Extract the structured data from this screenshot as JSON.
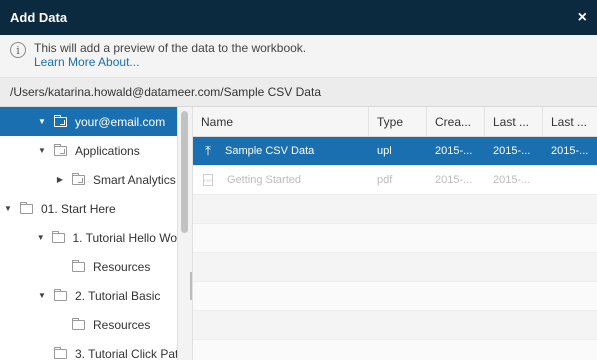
{
  "dialog": {
    "title": "Add Data",
    "close_glyph": "×"
  },
  "info": {
    "icon": "i",
    "message": "This will add a preview of the data to the workbook.",
    "link": "Learn More About..."
  },
  "path": "/Users/katarina.howald@datameer.com/Sample CSV Data",
  "tree": {
    "items": [
      {
        "label": "your@email.com",
        "caret": "▼",
        "icon": "shared-folder-icon"
      },
      {
        "label": "Applications",
        "caret": "▼",
        "icon": "shared-folder-icon"
      },
      {
        "label": "Smart Analytics",
        "caret": "▶",
        "icon": "shared-folder-icon"
      },
      {
        "label": "01. Start Here",
        "caret": "▼",
        "icon": "folder-icon"
      },
      {
        "label": "1. Tutorial Hello Wo",
        "caret": "▼",
        "icon": "folder-icon"
      },
      {
        "label": "Resources",
        "caret": "",
        "icon": "folder-icon"
      },
      {
        "label": "2. Tutorial Basic",
        "caret": "▼",
        "icon": "folder-icon"
      },
      {
        "label": "Resources",
        "caret": "",
        "icon": "folder-icon"
      },
      {
        "label": "3. Tutorial Click Pat",
        "caret": "",
        "icon": "folder-icon"
      }
    ]
  },
  "grid": {
    "columns": [
      "Name",
      "Type",
      "Crea...",
      "Last ...",
      "Last ..."
    ],
    "rows": [
      {
        "name": "Sample CSV Data",
        "type": "upl",
        "c1": "2015-...",
        "c2": "2015-...",
        "c3": "2015-...",
        "icon_glyph": "⤒",
        "pdf_glyph": ""
      },
      {
        "name": "Getting Started",
        "type": "pdf",
        "c1": "2015-...",
        "c2": "2015-...",
        "c3": "",
        "icon_glyph": "",
        "pdf_glyph": "PDF"
      }
    ]
  },
  "colors": {
    "titlebar": "#0b2a3f",
    "selection": "#1a6fb0",
    "link": "#1a6fb0"
  }
}
